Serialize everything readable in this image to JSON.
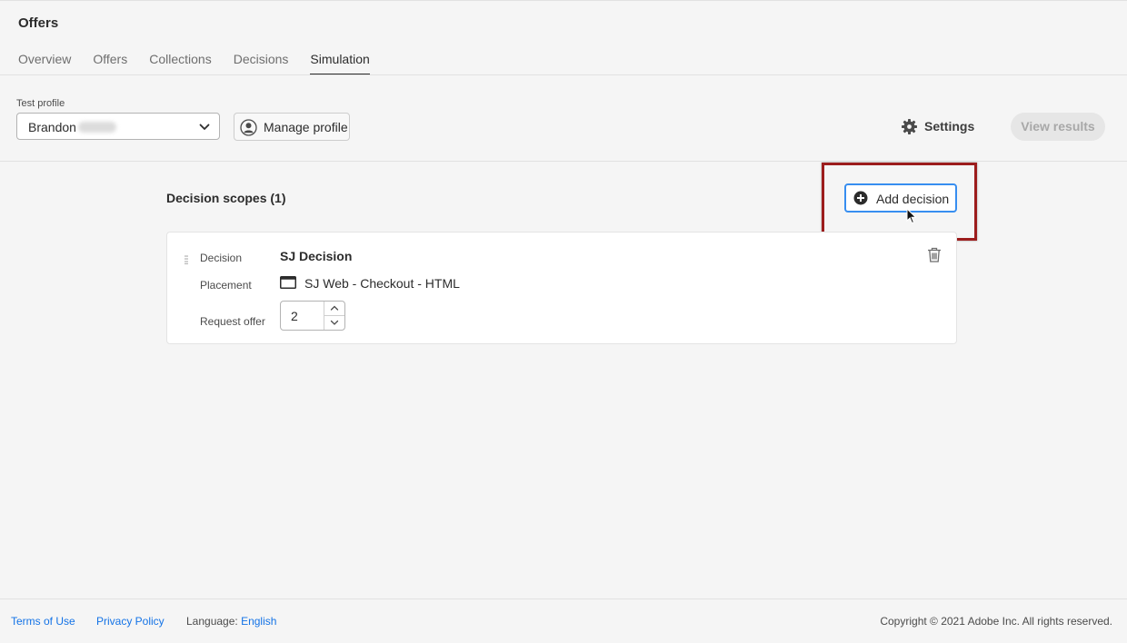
{
  "page": {
    "title": "Offers"
  },
  "tabs": [
    {
      "label": "Overview"
    },
    {
      "label": "Offers"
    },
    {
      "label": "Collections"
    },
    {
      "label": "Decisions"
    },
    {
      "label": "Simulation",
      "active": true
    }
  ],
  "toolbar": {
    "test_profile_label": "Test profile",
    "test_profile_value": "Brandon",
    "manage_profile_label": "Manage profile",
    "settings_label": "Settings",
    "view_results_label": "View results"
  },
  "scopes": {
    "title": "Decision scopes (1)",
    "add_decision_label": "Add decision",
    "card": {
      "decision_label": "Decision",
      "decision_value": "SJ Decision",
      "placement_label": "Placement",
      "placement_value": "SJ Web - Checkout - HTML",
      "request_offer_label": "Request offer",
      "request_offer_value": "2"
    }
  },
  "footer": {
    "terms": "Terms of Use",
    "privacy": "Privacy Policy",
    "language_label": "Language:",
    "language_value": "English",
    "copyright": "Copyright ©  2021 Adobe Inc.  All rights reserved."
  },
  "colors": {
    "accent_blue": "#378ef0",
    "link_blue": "#1473e6",
    "highlight_red": "#9c1c1c"
  },
  "icons": [
    "chevron-down-icon",
    "user-icon",
    "gear-icon",
    "add-circle-icon",
    "drag-handle-icon",
    "browser-window-icon",
    "chevron-up-icon",
    "trash-icon",
    "mouse-cursor-icon"
  ]
}
